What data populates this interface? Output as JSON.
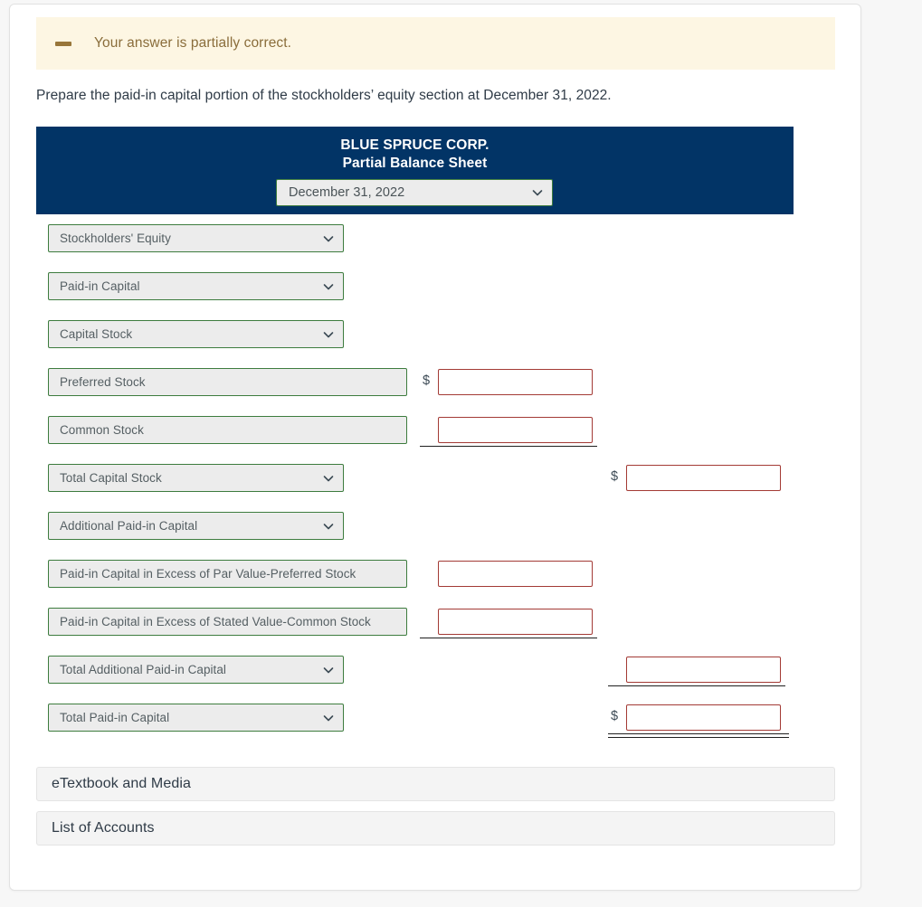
{
  "alert": {
    "icon": "minus-icon",
    "message": "Your answer is partially correct.",
    "bg_color": "#fdf6e3",
    "text_color": "#8a6d3b"
  },
  "instruction": "Prepare the paid-in capital portion of the stockholders’ equity section at December 31, 2022.",
  "statement": {
    "company": "BLUE SPRUCE CORP.",
    "title": "Partial Balance Sheet",
    "header_bg": "#023466",
    "date_select": {
      "value": "December 31, 2022",
      "icon": "chevron-down-icon"
    }
  },
  "rows": [
    {
      "id": "stockholders-equity",
      "kind": "select",
      "label": "Stockholders' Equity"
    },
    {
      "id": "paid-in-capital",
      "kind": "select",
      "label": "Paid-in Capital"
    },
    {
      "id": "capital-stock",
      "kind": "select",
      "label": "Capital Stock"
    },
    {
      "id": "preferred-stock",
      "kind": "account",
      "label": "Preferred Stock",
      "dollar": "$",
      "value": "",
      "column": "mid"
    },
    {
      "id": "common-stock",
      "kind": "account",
      "label": "Common Stock",
      "dollar": "",
      "value": "",
      "column": "mid",
      "underline": true
    },
    {
      "id": "total-capital-stock",
      "kind": "select",
      "label": "Total Capital Stock",
      "dollar": "$",
      "value": "",
      "column": "right"
    },
    {
      "id": "additional-paid-in-capital",
      "kind": "select",
      "label": "Additional Paid-in Capital"
    },
    {
      "id": "pic-excess-par-preferred",
      "kind": "account",
      "label": "Paid-in Capital in Excess of Par Value-Preferred Stock",
      "dollar": "",
      "value": "",
      "column": "mid"
    },
    {
      "id": "pic-excess-stated-common",
      "kind": "account",
      "label": "Paid-in Capital in Excess of Stated Value-Common Stock",
      "dollar": "",
      "value": "",
      "column": "mid",
      "underline": true
    },
    {
      "id": "total-additional-paid-in-capital",
      "kind": "select",
      "label": "Total Additional Paid-in Capital",
      "dollar": "",
      "value": "",
      "column": "right",
      "underline": true
    },
    {
      "id": "total-paid-in-capital",
      "kind": "select",
      "label": "Total Paid-in Capital",
      "dollar": "$",
      "value": "",
      "column": "right",
      "double_underline": true
    }
  ],
  "accordions": [
    {
      "id": "etextbook-and-media",
      "label": "eTextbook and Media"
    },
    {
      "id": "list-of-accounts",
      "label": "List of Accounts"
    }
  ],
  "colors": {
    "select_border": "#3d7c3e",
    "select_fill": "#ececec",
    "input_border": "#a33a35",
    "navy": "#023466"
  }
}
